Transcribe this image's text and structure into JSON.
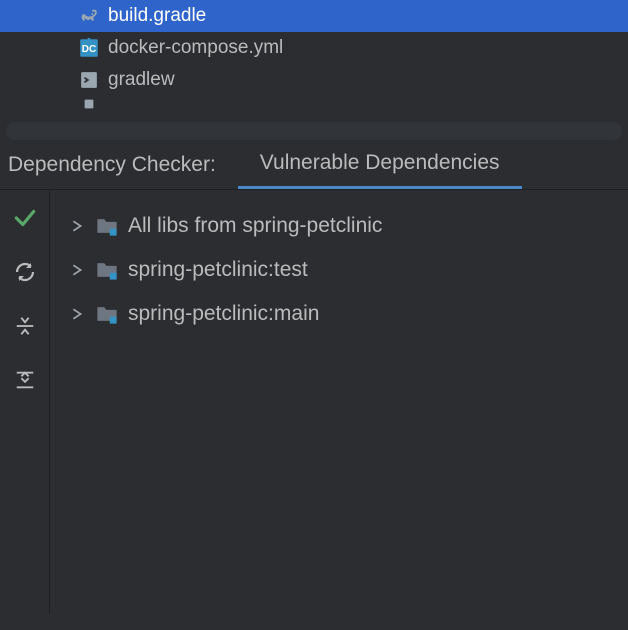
{
  "files": [
    {
      "name": "build.gradle",
      "icon": "gradle-icon",
      "selected": true
    },
    {
      "name": "docker-compose.yml",
      "icon": "docker-compose-icon",
      "selected": false
    },
    {
      "name": "gradlew",
      "icon": "script-icon",
      "selected": false
    }
  ],
  "toolWindow": {
    "title": "Dependency Checker:",
    "tab": "Vulnerable Dependencies"
  },
  "dependencies": [
    {
      "label": "All libs from spring-petclinic"
    },
    {
      "label": "spring-petclinic:test"
    },
    {
      "label": "spring-petclinic:main"
    }
  ]
}
